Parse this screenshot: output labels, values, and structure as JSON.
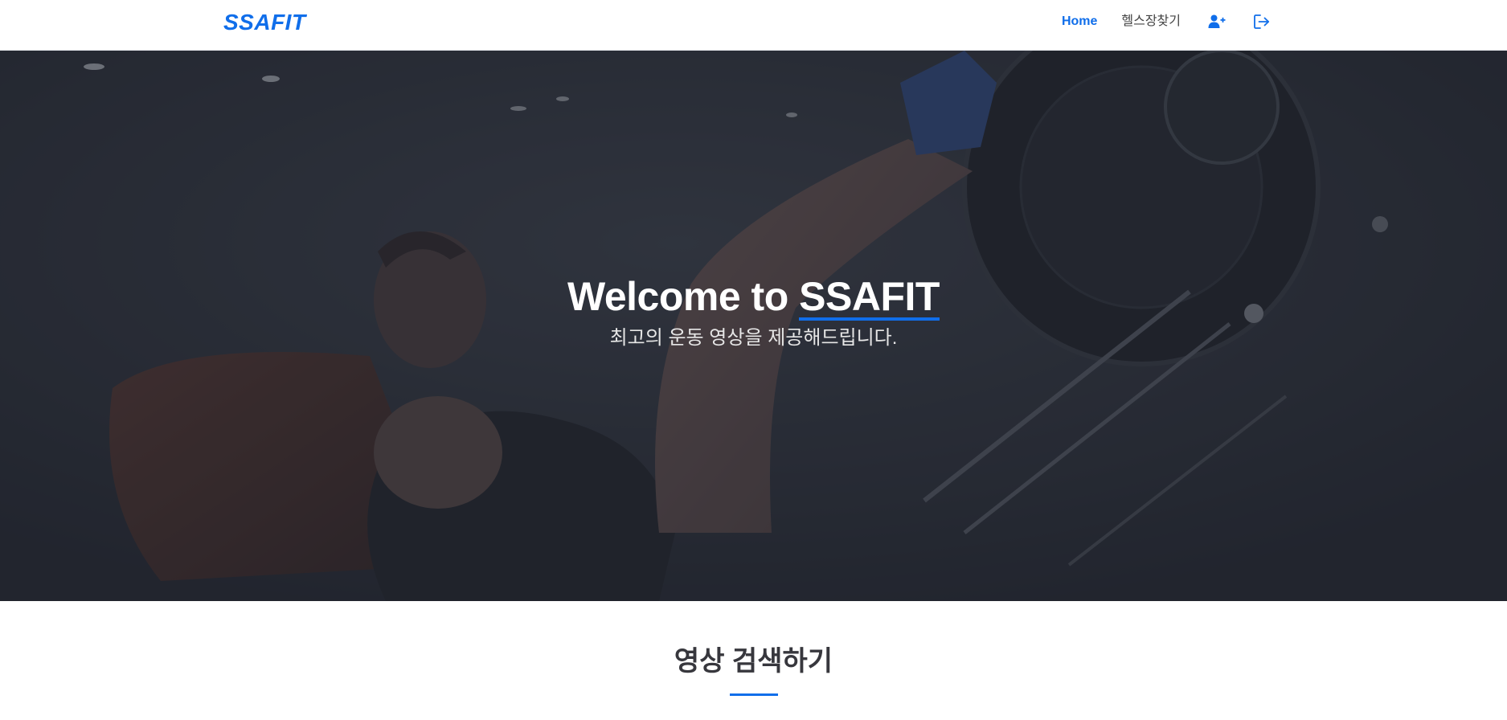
{
  "header": {
    "logo": "SSAFIT",
    "nav": {
      "home_label": "Home",
      "gym_label": "헬스장찾기",
      "signup_icon": "user-plus-icon",
      "logout_icon": "sign-out-icon"
    }
  },
  "hero": {
    "title_prefix": "Welcome to ",
    "title_brand": "SSAFIT",
    "subtitle": "최고의 운동 영상을 제공해드립니다."
  },
  "section": {
    "title": "영상 검색하기"
  },
  "colors": {
    "accent": "#106eea",
    "hero_overlay": "#262a34",
    "text_dark": "#37373d"
  }
}
